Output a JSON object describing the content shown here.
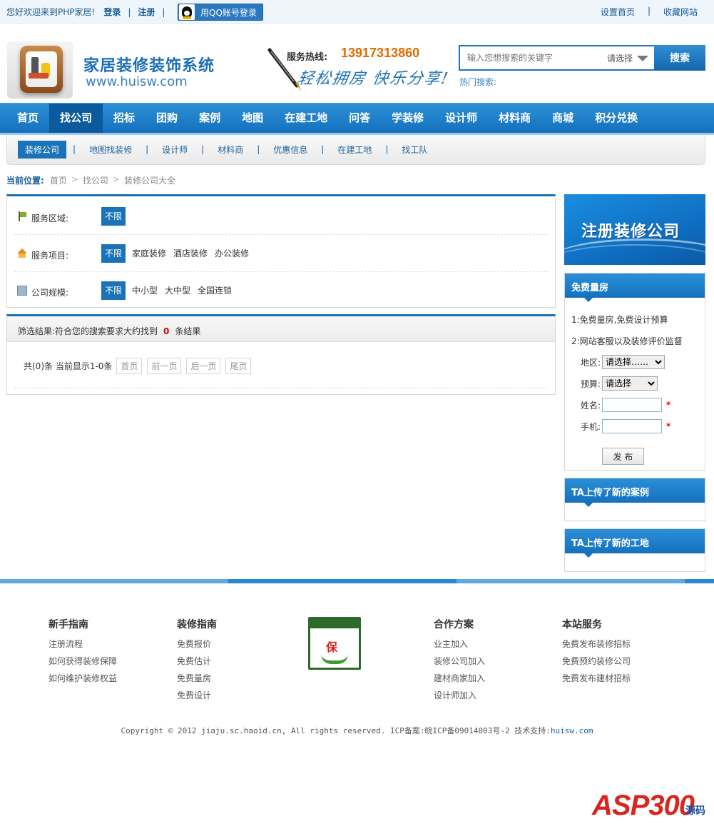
{
  "topbar": {
    "welcome": "您好欢迎来到PHP家居!",
    "login": "登录",
    "sep1": "|",
    "register": "注册",
    "sep2": "|",
    "qq_login": "用QQ账号登录",
    "set_home": "设置首页",
    "sep3": "|",
    "favorite": "收藏网站"
  },
  "header": {
    "site_name": "家居装修装饰系统",
    "site_url": "www.huisw.com",
    "hotline_label": "服务热线:",
    "hotline_number": "13917313860",
    "slogan": "轻松拥房 快乐分享!",
    "search": {
      "placeholder": "输入您想搜索的关键字",
      "select_label": "请选择",
      "button": "搜索",
      "hot_label": "热门搜索:"
    }
  },
  "mainnav": {
    "items": [
      "首页",
      "找公司",
      "招标",
      "团购",
      "案例",
      "地图",
      "在建工地",
      "问答",
      "学装修",
      "设计师",
      "材料商",
      "商城",
      "积分兑换"
    ],
    "active_index": 1
  },
  "subnav": {
    "items": [
      "装修公司",
      "地图找装修",
      "设计师",
      "材料商",
      "优惠信息",
      "在建工地",
      "找工队"
    ],
    "separator": "|"
  },
  "breadcrumb": {
    "label": "当前位置:",
    "items": [
      "首页",
      "找公司",
      "装修公司大全"
    ],
    "sep": ">"
  },
  "filter": {
    "rows": [
      {
        "label": "服务区域:",
        "selected": "不限",
        "options": []
      },
      {
        "label": "服务项目:",
        "selected": "不限",
        "options": [
          "家庭装修",
          "酒店装修",
          "办公装修"
        ]
      },
      {
        "label": "公司规模:",
        "selected": "不限",
        "options": [
          "中小型",
          "大中型",
          "全国连锁"
        ]
      }
    ]
  },
  "results": {
    "prefix": "筛选结果:符合您的搜索要求大约找到",
    "count": "0",
    "suffix": "条结果",
    "pager_info": "共(0)条 当前显示1-0条",
    "first": "首页",
    "prev": "前一页",
    "next": "后一页",
    "last": "尾页"
  },
  "sidebar": {
    "banner": "注册装修公司",
    "free_measure": {
      "title": "免费量房",
      "line1": "1:免费量房,免费设计预算",
      "line2": "2:网站客服以及装修评价监督",
      "region_label": "地区:",
      "region_value": "请选择……",
      "budget_label": "预算:",
      "budget_value": "请选择",
      "name_label": "姓名:",
      "phone_label": "手机:",
      "required": "*",
      "submit": "发 布"
    },
    "new_cases_title": "TA上传了新的案例",
    "new_sites_title": "TA上传了新的工地"
  },
  "footer": {
    "columns": [
      {
        "title": "新手指南",
        "links": [
          "注册流程",
          "如何获得装修保障",
          "如何维护装修权益"
        ]
      },
      {
        "title": "装修指南",
        "links": [
          "免费报价",
          "免费估计",
          "免费量房",
          "免费设计"
        ]
      },
      {
        "title": "合作方案",
        "links": [
          "业主加入",
          "装修公司加入",
          "建材商家加入",
          "设计师加入"
        ]
      },
      {
        "title": "本站服务",
        "links": [
          "免费发布装修招标",
          "免费预约装修公司",
          "免费发布建材招标"
        ]
      }
    ],
    "guarantee_char": "保",
    "copyright": "Copyright © 2012 jiaju.sc.haoid.cn, All rights reserved. ICP备案:皖ICP备09014003号-2 技术支持:",
    "support_link": "huisw.com"
  },
  "watermark": {
    "brand": "ASP300",
    "suffix": "源码"
  },
  "colors": {
    "primary": "#1a73b9",
    "accent_orange": "#e06b00",
    "count_red": "#d10000"
  }
}
